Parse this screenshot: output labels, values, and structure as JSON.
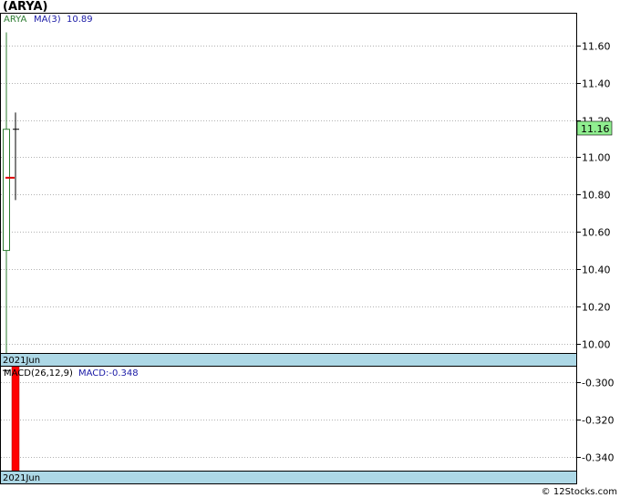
{
  "title": "(ARYA)",
  "footer": "© 12Stocks.com",
  "colors": {
    "up": "#2e7d32",
    "ma": "#dd0000",
    "label_box": "#90ee90",
    "date_band": "#add8e6",
    "macd_bar": "#ff0000",
    "grid": "#999999",
    "legend_symbol": "#2e7d32",
    "legend_text": "#1a1aa6"
  },
  "chart_data": [
    {
      "type": "candlestick",
      "legend": {
        "symbol": "ARYA",
        "ma_label": "MA(3)",
        "ma_value": "10.89"
      },
      "ylim": [
        9.95,
        11.77
      ],
      "yticks": [
        10.0,
        10.2,
        10.4,
        10.6,
        10.8,
        11.0,
        11.2,
        11.4,
        11.6
      ],
      "x_label": "2021Jun",
      "grid": true,
      "last_value_label": "11.16",
      "candles": [
        {
          "open": 10.5,
          "close": 11.15,
          "high": 11.67,
          "low": 9.95,
          "direction": "up"
        },
        {
          "open": 11.15,
          "close": 11.15,
          "high": 11.24,
          "low": 10.77,
          "direction": "flat"
        }
      ],
      "ma_points": [
        {
          "index": 0,
          "value": 10.89
        }
      ]
    },
    {
      "type": "bar",
      "legend": {
        "label": "MACD(26,12,9)",
        "value_label": "MACD:-0.348"
      },
      "ylim": [
        -0.347,
        -0.292
      ],
      "yticks": [
        -0.3,
        -0.32,
        -0.34
      ],
      "x_label": "2021Jun",
      "grid": true,
      "values": [
        -0.348
      ],
      "signal": [
        -0.294
      ]
    }
  ]
}
